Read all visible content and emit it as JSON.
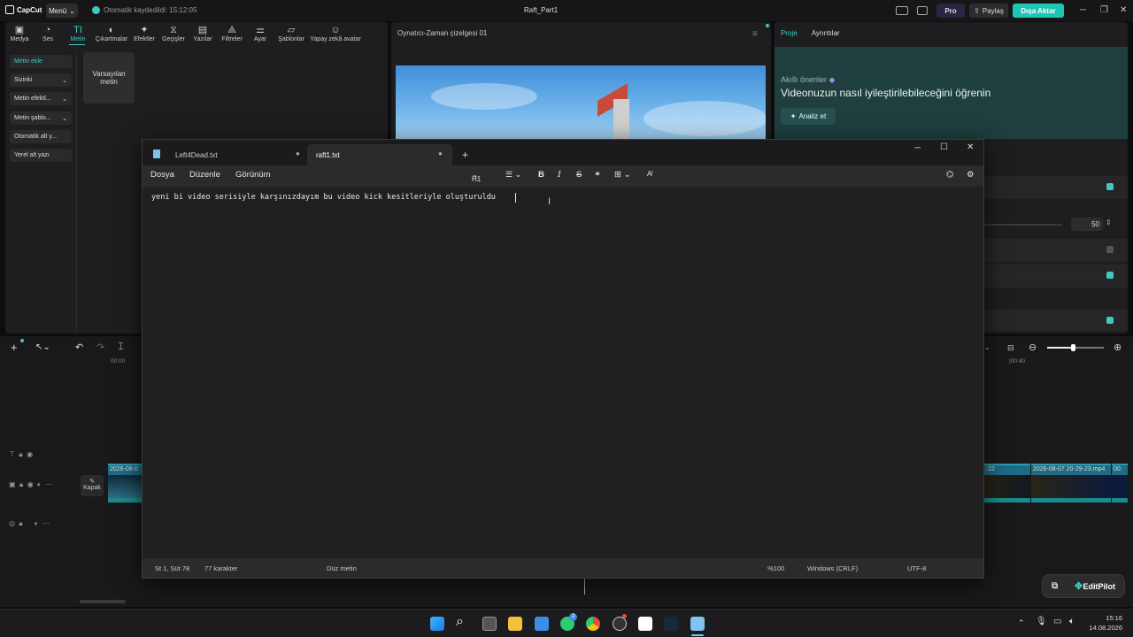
{
  "capcut": {
    "logo": "CapCut",
    "menu_label": "Menü",
    "autosave": "Otomatik kaydedildi: 15:12:05",
    "project_title": "Raft_Part1",
    "pro": "Pro",
    "share": "Paylaş",
    "export": "Dışa Aktar",
    "toolbar": [
      "Medya",
      "Ses",
      "Metin",
      "Çıkartmalar",
      "Efektler",
      "Geçişler",
      "Yazılar",
      "Filtreler",
      "Ayar",
      "Şablonlar",
      "Yapay zekâ avatar"
    ],
    "sidebar": [
      "Metin ekle",
      "Sizinki",
      "Metin efektl...",
      "Metin şablo...",
      "Otomatik alt y...",
      "Yerel alt yazı"
    ],
    "default_text_card": "Varsayılan metin",
    "player_title": "Oynatıcı-Zaman çizelgesi 01",
    "right_tabs": [
      "Proje",
      "Ayrıntılar"
    ],
    "ai_suggest_label": "Akıllı öneriler",
    "ai_suggest_text": "Videonuzun nasıl iyileştirilebileceğini öğrenin",
    "analyze_button": "Analiz et",
    "slider_value": "50",
    "time_start": "00:00",
    "time_right": "|00:40",
    "cover_label": "Kapak",
    "clip1": "2026-08-0",
    "clip2": ":22",
    "clip3": "2026-08-07 20-29-23.mp4",
    "clip4": "00:",
    "editpilot": "EditPilot"
  },
  "notepad": {
    "tabs": [
      {
        "label": "Left4Dead.txt"
      },
      {
        "label": "raft1.txt"
      }
    ],
    "menu": [
      "Dosya",
      "Düzenle",
      "Görünüm"
    ],
    "heading_select": "H1",
    "content": "yeni bi video serisiyle karşınızdayım bu video kick kesitleriyle oluşturuldu",
    "status": {
      "position": "St 1, Süt 78",
      "chars": "77 karakter",
      "format": "Düz metin",
      "zoom": "%100",
      "line_ending": "Windows (CRLF)",
      "encoding": "UTF-8"
    }
  },
  "taskbar": {
    "time": "15:16",
    "date": "14.08.2026",
    "badge": "2"
  },
  "colors": {
    "accent": "#3ec9c0",
    "export": "#1fc6b6"
  }
}
